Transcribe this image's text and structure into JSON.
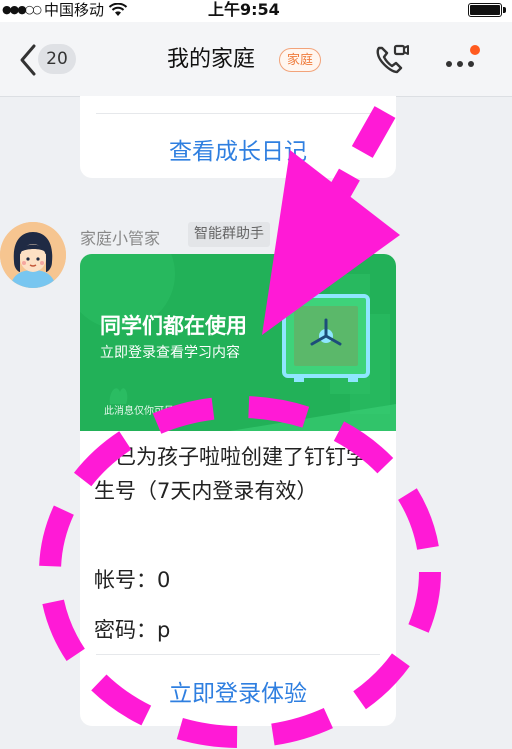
{
  "status_bar": {
    "carrier": "中国移动",
    "time": "上午9:54",
    "wifi_icon": "wifi-icon",
    "battery_level": 1.0
  },
  "nav": {
    "unread_count": "20",
    "title": "我的家庭",
    "badge": "家庭"
  },
  "prev_card": {
    "link_label": "查看成长日记"
  },
  "message": {
    "sender_name": "家庭小管家",
    "sender_tag": "智能群助手",
    "banner": {
      "title": "同学们都在使用",
      "subtitle": "立即登录查看学习内容",
      "note": "此消息仅你可见"
    },
    "body_text": "你已为孩子啦啦创建了钉钉学生号（7天内登录有效）",
    "account_label": "帐号：",
    "account_value": "0",
    "password_label": "密码：",
    "password_value": "p",
    "cta_label": "立即登录体验"
  },
  "colors": {
    "link_blue": "#2f7fe0",
    "banner_green": "#22b158",
    "annotation_magenta": "#ff1ad6",
    "badge_orange": "#f07c3c"
  }
}
